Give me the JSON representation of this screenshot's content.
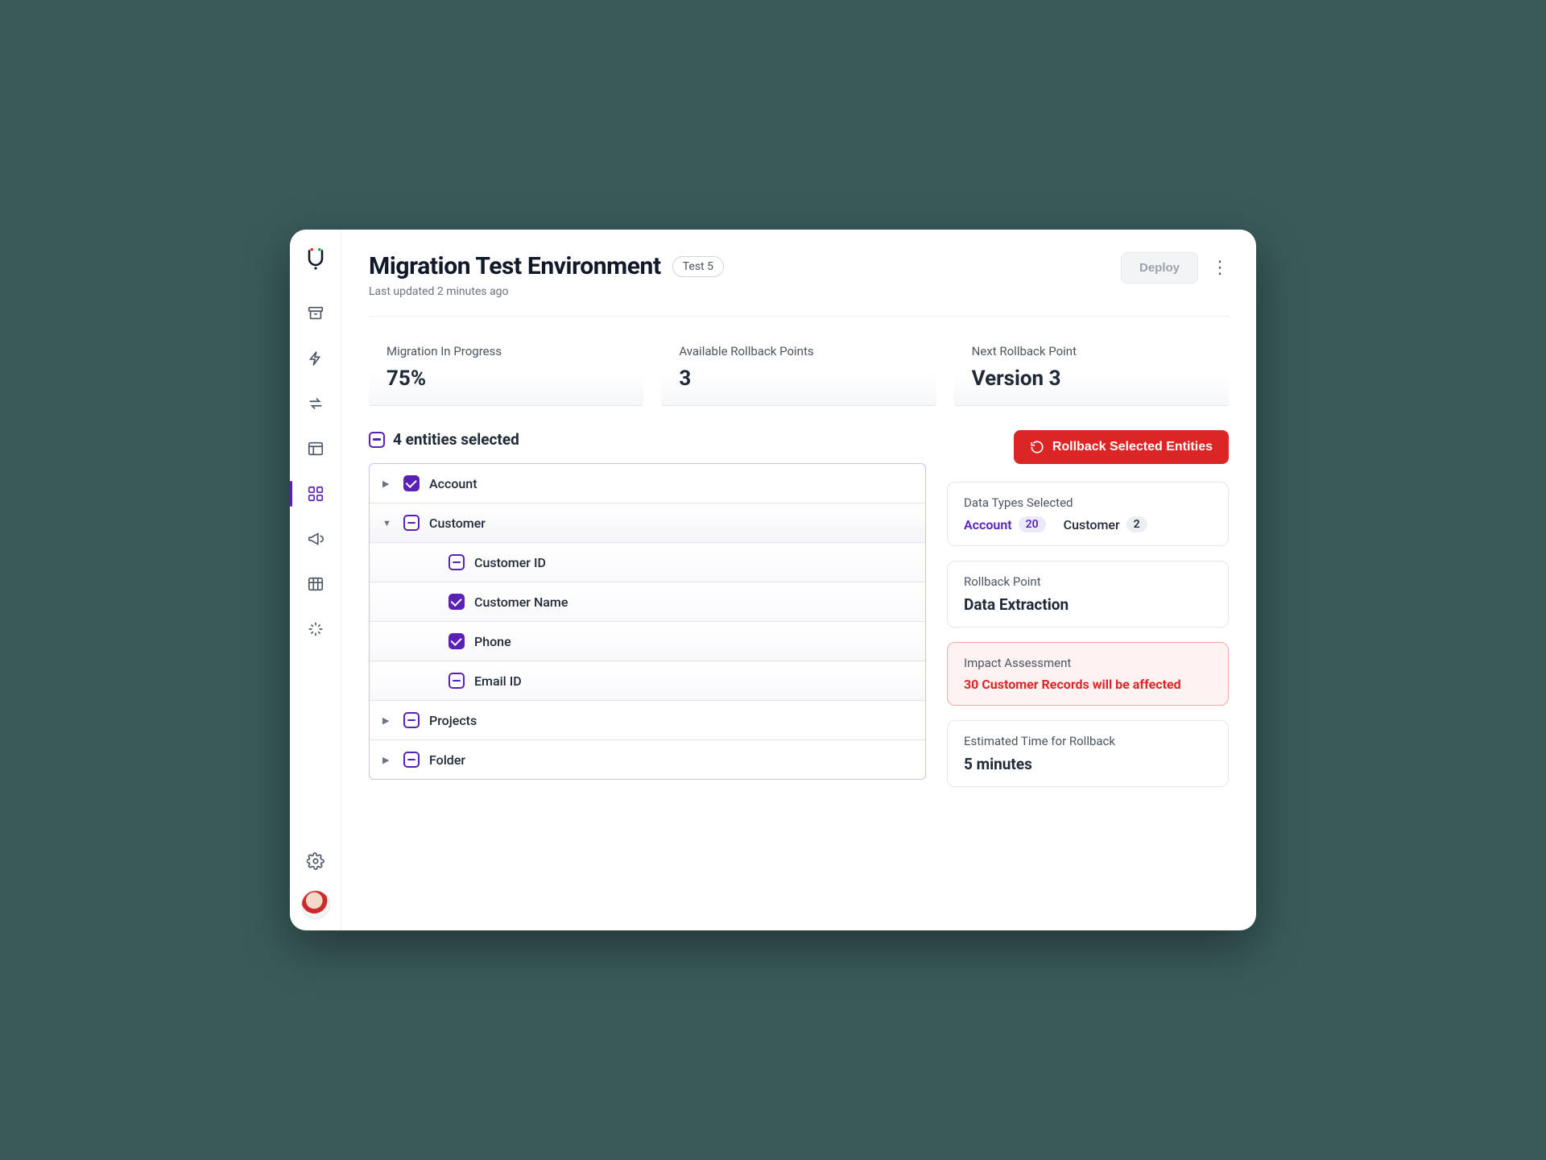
{
  "header": {
    "title": "Migration Test Environment",
    "badge": "Test 5",
    "subtitle": "Last updated 2 minutes ago",
    "deploy_label": "Deploy"
  },
  "kpis": [
    {
      "label": "Migration In Progress",
      "value": "75%"
    },
    {
      "label": "Available Rollback Points",
      "value": "3"
    },
    {
      "label": "Next Rollback Point",
      "value": "Version 3"
    }
  ],
  "selection": {
    "summary": "4 entities selected",
    "tree": {
      "account": "Account",
      "customer": "Customer",
      "customer_children": {
        "id": "Customer ID",
        "name": "Customer Name",
        "phone": "Phone",
        "email": "Email ID"
      },
      "projects": "Projects",
      "folder": "Folder"
    }
  },
  "rollback_button": "Rollback Selected Entities",
  "panels": {
    "data_types": {
      "label": "Data Types Selected",
      "chips": {
        "account_label": "Account",
        "account_count": "20",
        "customer_label": "Customer",
        "customer_count": "2"
      }
    },
    "rollback_point": {
      "label": "Rollback Point",
      "value": "Data Extraction"
    },
    "impact": {
      "label": "Impact Assessment",
      "value": "30 Customer Records will be affected"
    },
    "eta": {
      "label": "Estimated Time for Rollback",
      "value": "5 minutes"
    }
  }
}
